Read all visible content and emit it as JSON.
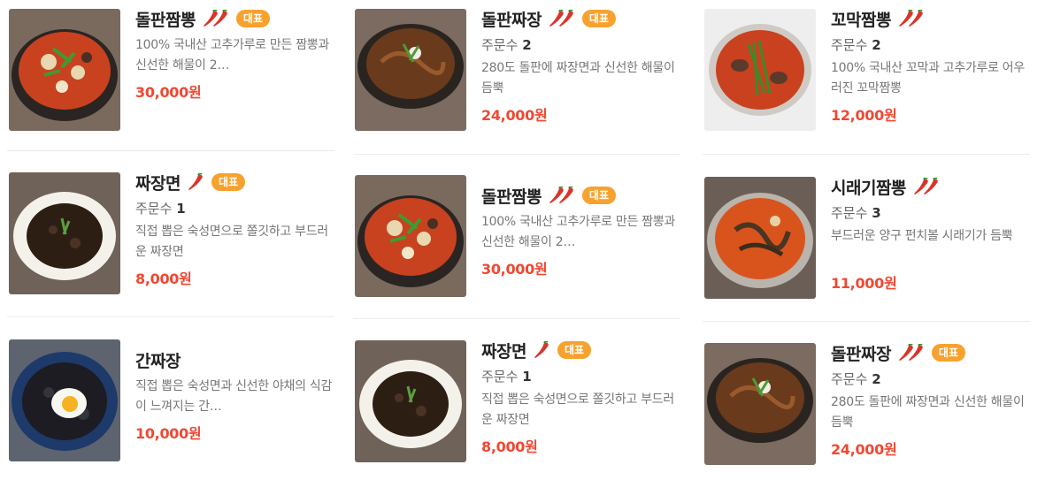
{
  "colors": {
    "price": "#f04832",
    "badge": "#f7a22e",
    "chili": "#d9342b"
  },
  "menu": [
    [
      {
        "name": "돌판짬뽕",
        "spicy": 2,
        "badge": "대표",
        "orders_label": "",
        "orders_value": "",
        "desc": "100% 국내산 고추가루로 만든 짬뽕과 신선한 해물이 2…",
        "price": "30,000원",
        "image": "jjamppong-stone-pot"
      },
      {
        "name": "짜장면",
        "spicy": 1,
        "badge": "대표",
        "orders_label": "주문수",
        "orders_value": "1",
        "desc": "직접 뽑은 숙성면으로 쫄깃하고 부드러운 짜장면",
        "price": "8,000원",
        "image": "jjajangmyeon-bowl"
      },
      {
        "name": "간짜장",
        "spicy": 0,
        "badge": "",
        "orders_label": "",
        "orders_value": "",
        "desc": "직접 뽑은 숙성면과 신선한 야채의 식감이 느껴지는 간…",
        "price": "10,000원",
        "image": "ganjjajang-egg"
      }
    ],
    [
      {
        "name": "돌판짜장",
        "spicy": 2,
        "badge": "대표",
        "orders_label": "주문수",
        "orders_value": "2",
        "desc": "280도 돌판에 짜장면과 신선한 해물이 듬뿍",
        "price": "24,000원",
        "image": "jjajang-stone-pot"
      },
      {
        "name": "돌판짬뽕",
        "spicy": 2,
        "badge": "대표",
        "orders_label": "",
        "orders_value": "",
        "desc": "100% 국내산 고추가루로 만든 짬뽕과 신선한 해물이 2…",
        "price": "30,000원",
        "image": "jjamppong-stone-pot"
      },
      {
        "name": "짜장면",
        "spicy": 1,
        "badge": "대표",
        "orders_label": "주문수",
        "orders_value": "1",
        "desc": "직접 뽑은 숙성면으로 쫄깃하고 부드러운 짜장면",
        "price": "8,000원",
        "image": "jjajangmyeon-bowl"
      }
    ],
    [
      {
        "name": "꼬막짬뽕",
        "spicy": 2,
        "badge": "",
        "orders_label": "주문수",
        "orders_value": "2",
        "desc": "100% 국내산 꼬막과 고추가루로 어우러진 꼬막짬뽕",
        "price": "12,000원",
        "image": "kkomak-jjamppong"
      },
      {
        "name": "시래기짬뽕",
        "spicy": 2,
        "badge": "",
        "orders_label": "주문수",
        "orders_value": "3",
        "desc": "부드러운 양구 펀치볼 시래기가 듬뿍",
        "price": "11,000원",
        "image": "siraegi-jjamppong"
      },
      {
        "name": "돌판짜장",
        "spicy": 2,
        "badge": "대표",
        "orders_label": "주문수",
        "orders_value": "2",
        "desc": "280도 돌판에 짜장면과 신선한 해물이 듬뿍",
        "price": "24,000원",
        "image": "jjajang-stone-pot"
      }
    ]
  ]
}
